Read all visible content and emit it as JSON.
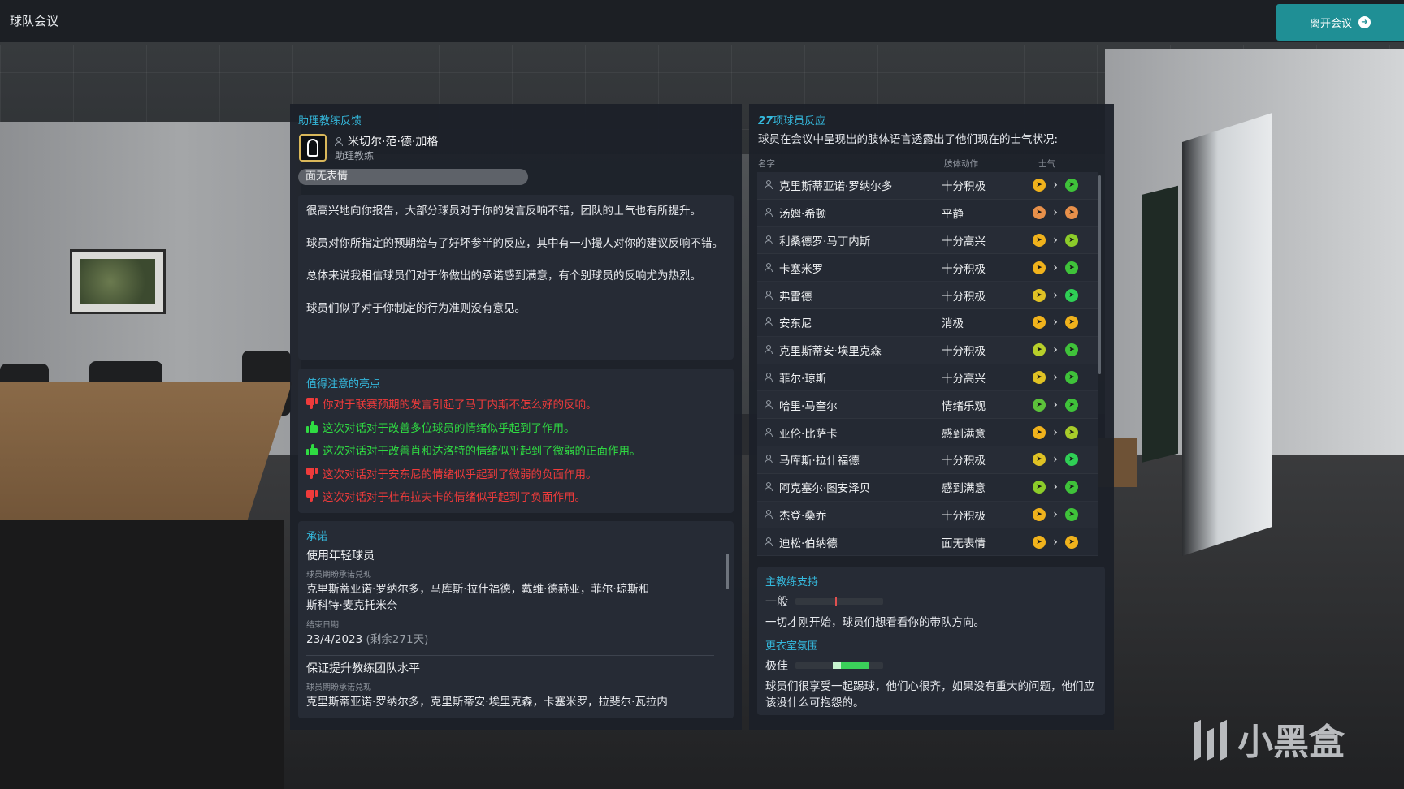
{
  "topbar": {
    "title": "球队会议",
    "leave_label": "离开会议"
  },
  "coach": {
    "section_title": "助理教练反馈",
    "name": "米切尔·范·德·加格",
    "role": "助理教练",
    "expression": "面无表情",
    "feedback": [
      "很高兴地向你报告，大部分球员对于你的发言反响不错，团队的士气也有所提升。",
      "球员对你所指定的预期给与了好坏参半的反应，其中有一小撮人对你的建议反响不错。",
      "总体来说我相信球员们对于你做出的承诺感到满意，有个别球员的反响尤为热烈。",
      "球员们似乎对于你制定的行为准则没有意见。"
    ]
  },
  "highlights": {
    "title": "值得注意的亮点",
    "items": [
      {
        "text": "你对于联赛预期的发言引起了马丁内斯不怎么好的反响。",
        "type": "negative"
      },
      {
        "text": "这次对话对于改善多位球员的情绪似乎起到了作用。",
        "type": "positive"
      },
      {
        "text": "这次对话对于改善肖和达洛特的情绪似乎起到了微弱的正面作用。",
        "type": "positive"
      },
      {
        "text": "这次对话对于安东尼的情绪似乎起到了微弱的负面作用。",
        "type": "negative"
      },
      {
        "text": "这次对话对于杜布拉夫卡的情绪似乎起到了负面作用。",
        "type": "negative"
      }
    ]
  },
  "promises": {
    "title": "承诺",
    "items": [
      {
        "title": "使用年轻球员",
        "expect_label": "球员期盼承诺兑现",
        "players": "克里斯蒂亚诺·罗纳尔多，马库斯·拉什福德，戴维·德赫亚，菲尔·琼斯和斯科特·麦克托米奈",
        "end_label": "结束日期",
        "end_date": "23/4/2023",
        "remaining": "(剩余271天)"
      },
      {
        "title": "保证提升教练团队水平",
        "expect_label": "球员期盼承诺兑现",
        "players": "克里斯蒂亚诺·罗纳尔多，克里斯蒂安·埃里克森，卡塞米罗，拉斐尔·瓦拉内"
      }
    ]
  },
  "reactions": {
    "count": "27",
    "title_suffix": "项球员反应",
    "description": "球员在会议中呈现出的肢体语言透露出了他们现在的士气状况:",
    "col_name": "名字",
    "col_body": "肢体动作",
    "col_morale": "士气",
    "rows": [
      {
        "name": "克里斯蒂亚诺·罗纳尔多",
        "body": "十分积极",
        "from": "#f0b21c",
        "to": "#3fc23a"
      },
      {
        "name": "汤姆·希顿",
        "body": "平静",
        "from": "#e8904a",
        "to": "#e8904a"
      },
      {
        "name": "利桑德罗·马丁内斯",
        "body": "十分高兴",
        "from": "#f0b21c",
        "to": "#8ccc2a"
      },
      {
        "name": "卡塞米罗",
        "body": "十分积极",
        "from": "#f0b21c",
        "to": "#3fc23a"
      },
      {
        "name": "弗雷德",
        "body": "十分积极",
        "from": "#e0c224",
        "to": "#2fcf55"
      },
      {
        "name": "安东尼",
        "body": "消极",
        "from": "#f0b21c",
        "to": "#f0b21c"
      },
      {
        "name": "克里斯蒂安·埃里克森",
        "body": "十分积极",
        "from": "#b8cf2a",
        "to": "#3fc23a"
      },
      {
        "name": "菲尔·琼斯",
        "body": "十分高兴",
        "from": "#e0c224",
        "to": "#3fc23a"
      },
      {
        "name": "哈里·马奎尔",
        "body": "情绪乐观",
        "from": "#5cc23a",
        "to": "#3fc23a"
      },
      {
        "name": "亚伦·比萨卡",
        "body": "感到满意",
        "from": "#f0b21c",
        "to": "#a8cc2a"
      },
      {
        "name": "马库斯·拉什福德",
        "body": "十分积极",
        "from": "#e0c224",
        "to": "#2fcf55"
      },
      {
        "name": "阿克塞尔·图安泽贝",
        "body": "感到满意",
        "from": "#8ccc2a",
        "to": "#3fc23a"
      },
      {
        "name": "杰登·桑乔",
        "body": "十分积极",
        "from": "#f0b21c",
        "to": "#3fc23a"
      },
      {
        "name": "迪松·伯纳德",
        "body": "面无表情",
        "from": "#f0b21c",
        "to": "#f0b21c"
      }
    ]
  },
  "support": {
    "title": "主教练支持",
    "level": "一般",
    "level_value": 0.45,
    "text": "一切才刚开始，球员们想看看你的带队方向。",
    "atmosphere_title": "更衣室氛围",
    "atmosphere_level": "极佳",
    "atmosphere_value": 0.85,
    "atmosphere_text": "球员们很享受一起踢球，他们心很齐，如果没有重大的问题，他们应该没什么可抱怨的。"
  },
  "watermark": {
    "text": "小黑盒"
  }
}
